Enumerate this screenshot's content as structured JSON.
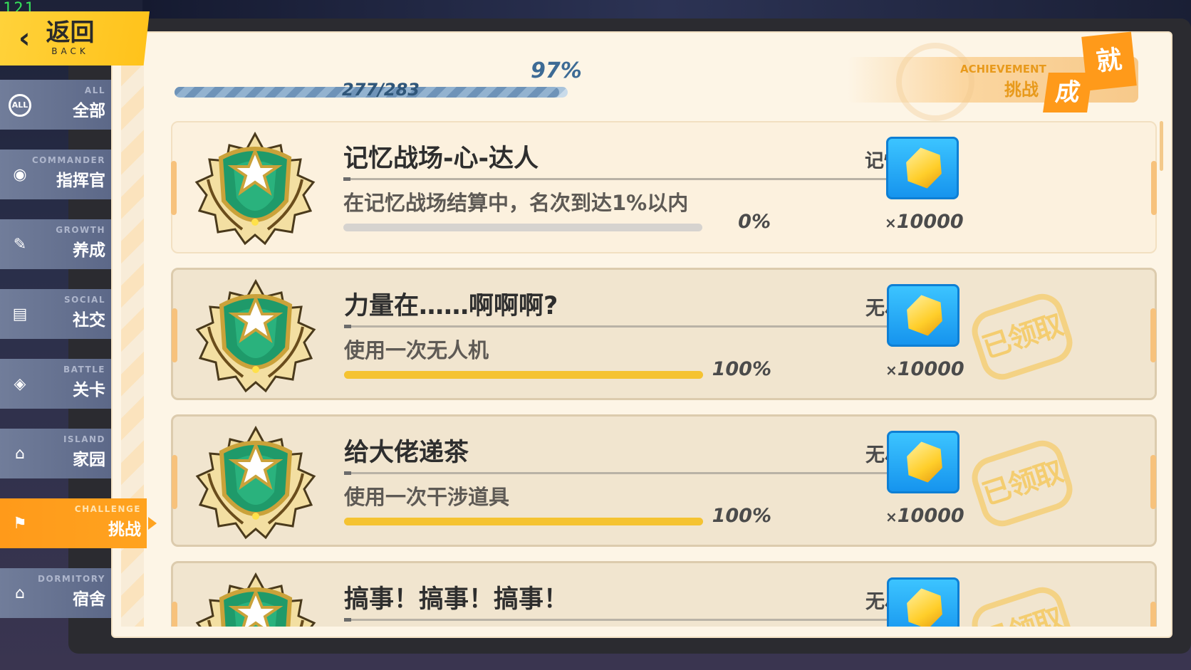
{
  "fps": "121",
  "back": {
    "cn": "返回",
    "en": "BACK"
  },
  "sidebar": {
    "items": [
      {
        "en": "ALL",
        "cn": "全部",
        "icon": "all-icon",
        "glyph": "ALL",
        "active": false
      },
      {
        "en": "COMMANDER",
        "cn": "指挥官",
        "icon": "commander-icon",
        "glyph": "◉",
        "active": false
      },
      {
        "en": "GROWTH",
        "cn": "养成",
        "icon": "notebook-icon",
        "glyph": "✎",
        "active": false
      },
      {
        "en": "SOCIAL",
        "cn": "社交",
        "icon": "id-card-icon",
        "glyph": "▤",
        "active": false
      },
      {
        "en": "BATTLE",
        "cn": "关卡",
        "icon": "map-pin-icon",
        "glyph": "◈",
        "active": false
      },
      {
        "en": "ISLAND",
        "cn": "家园",
        "icon": "home-icon",
        "glyph": "⌂",
        "active": false
      },
      {
        "en": "CHALLENGE",
        "cn": "挑战",
        "icon": "flag-icon",
        "glyph": "⚑",
        "active": true
      },
      {
        "en": "DORMITORY",
        "cn": "宿舍",
        "icon": "dormitory-icon",
        "glyph": "⌂",
        "active": false
      }
    ]
  },
  "progress": {
    "percent_text": "97%",
    "count_text": "277/283",
    "fraction": 0.979
  },
  "badge": {
    "en": "ACHIEVEMENT",
    "cn": "挑战",
    "tile1": "成",
    "tile2": "就"
  },
  "achievements": [
    {
      "title": "记忆战场-心-达人",
      "category": "记忆战场",
      "desc": "在记忆战场结算中，名次到达1%以内",
      "progress": 0,
      "pct_text": "0%",
      "reward_x": "×",
      "reward_qty": "10000",
      "claimed": false,
      "stamp": ""
    },
    {
      "title": "力量在……啊啊啊?",
      "category": "无尽深渊",
      "desc": "使用一次无人机",
      "progress": 1,
      "pct_text": "100%",
      "reward_x": "×",
      "reward_qty": "10000",
      "claimed": true,
      "stamp": "已领取"
    },
    {
      "title": "给大佬递茶",
      "category": "无尽深渊",
      "desc": "使用一次干涉道具",
      "progress": 1,
      "pct_text": "100%",
      "reward_x": "×",
      "reward_qty": "10000",
      "claimed": true,
      "stamp": "已领取"
    },
    {
      "title": "搞事！搞事！搞事！",
      "category": "无尽深渊",
      "desc": "",
      "progress": 1,
      "pct_text": "",
      "reward_x": "",
      "reward_qty": "",
      "claimed": true,
      "stamp": "已领取"
    }
  ],
  "colors": {
    "accent": "#ffa31f",
    "yellow": "#ffc21a",
    "bar_fill": "#f5c331",
    "gem_blue": "#1694ee"
  }
}
